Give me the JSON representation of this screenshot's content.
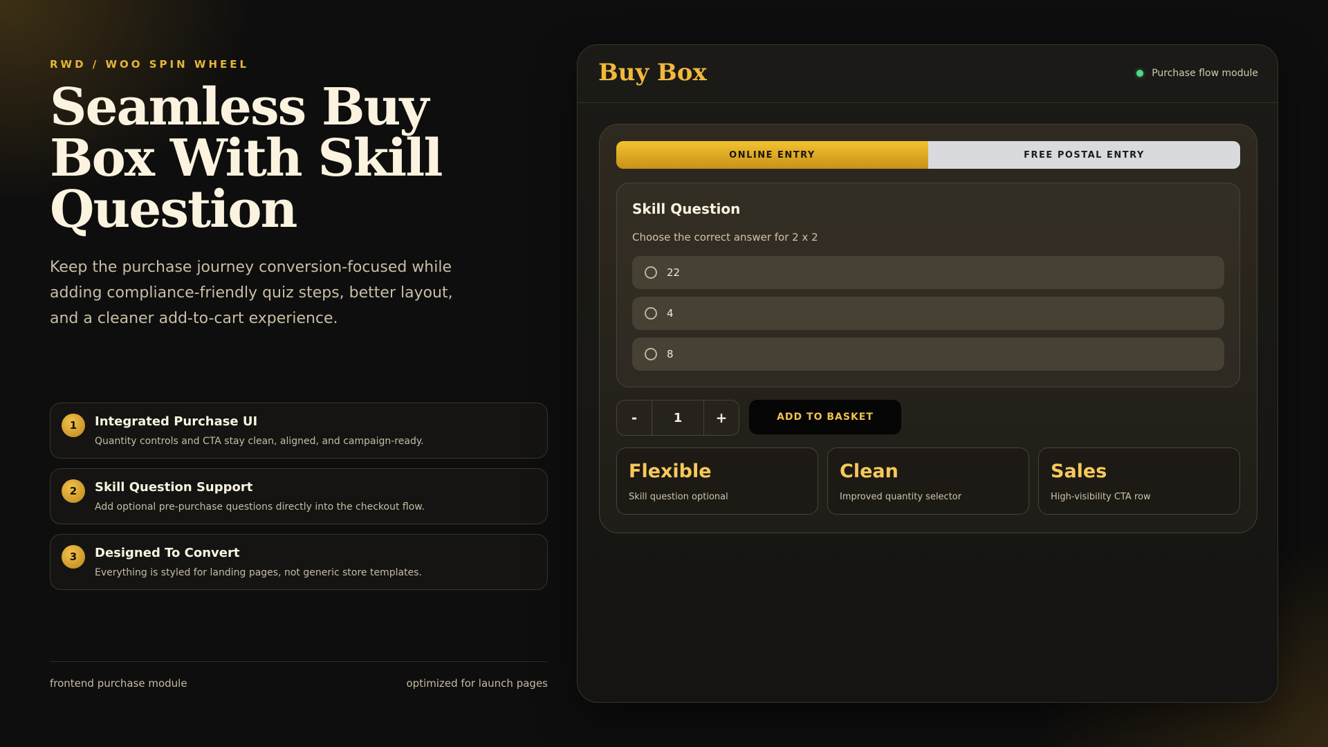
{
  "left": {
    "eyebrow": "RWD / WOO SPIN WHEEL",
    "title": "Seamless Buy Box With Skill Question",
    "description": "Keep the purchase journey conversion-focused while adding compliance-friendly quiz steps, better layout, and a cleaner add-to-cart experience.",
    "features": [
      {
        "num": "1",
        "title": "Integrated Purchase UI",
        "desc": "Quantity controls and CTA stay clean, aligned, and campaign-ready."
      },
      {
        "num": "2",
        "title": "Skill Question Support",
        "desc": "Add optional pre-purchase questions directly into the checkout flow."
      },
      {
        "num": "3",
        "title": "Designed To Convert",
        "desc": "Everything is styled for landing pages, not generic store templates."
      }
    ],
    "footer_left": "frontend purchase module",
    "footer_right": "optimized for launch pages"
  },
  "panel": {
    "title": "Buy Box",
    "status": "Purchase flow module",
    "status_color": "#4fd889",
    "tabs": [
      {
        "label": "ONLINE ENTRY",
        "active": true
      },
      {
        "label": "FREE POSTAL ENTRY",
        "active": false
      }
    ],
    "quiz": {
      "title": "Skill Question",
      "question": "Choose the correct answer for 2 x 2",
      "options": [
        "22",
        "4",
        "8"
      ]
    },
    "quantity": {
      "minus": "-",
      "value": "1",
      "plus": "+"
    },
    "add_button": "ADD TO BASKET",
    "cards": [
      {
        "title": "Flexible",
        "desc": "Skill question optional"
      },
      {
        "title": "Clean",
        "desc": "Improved quantity selector"
      },
      {
        "title": "Sales",
        "desc": "High-visibility CTA row"
      }
    ]
  },
  "colors": {
    "accent": "#f0b83c",
    "background": "#0e0e0e"
  }
}
